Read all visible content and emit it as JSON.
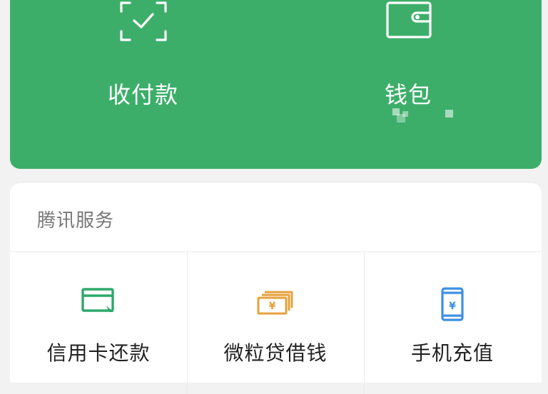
{
  "top_actions": [
    {
      "label": "收付款",
      "icon": "scan-check-icon"
    },
    {
      "label": "钱包",
      "icon": "wallet-icon",
      "balance_hidden": true
    }
  ],
  "services": {
    "title": "腾讯服务",
    "items": [
      {
        "label": "信用卡还款",
        "icon": "credit-card-icon",
        "color": "#2fa86b"
      },
      {
        "label": "微粒贷借钱",
        "icon": "money-bills-icon",
        "color": "#e5a23c"
      },
      {
        "label": "手机充值",
        "icon": "phone-recharge-icon",
        "color": "#3d8fe3"
      }
    ]
  },
  "colors": {
    "brand_green": "#3dae6a",
    "background": "#f2f2f2"
  }
}
